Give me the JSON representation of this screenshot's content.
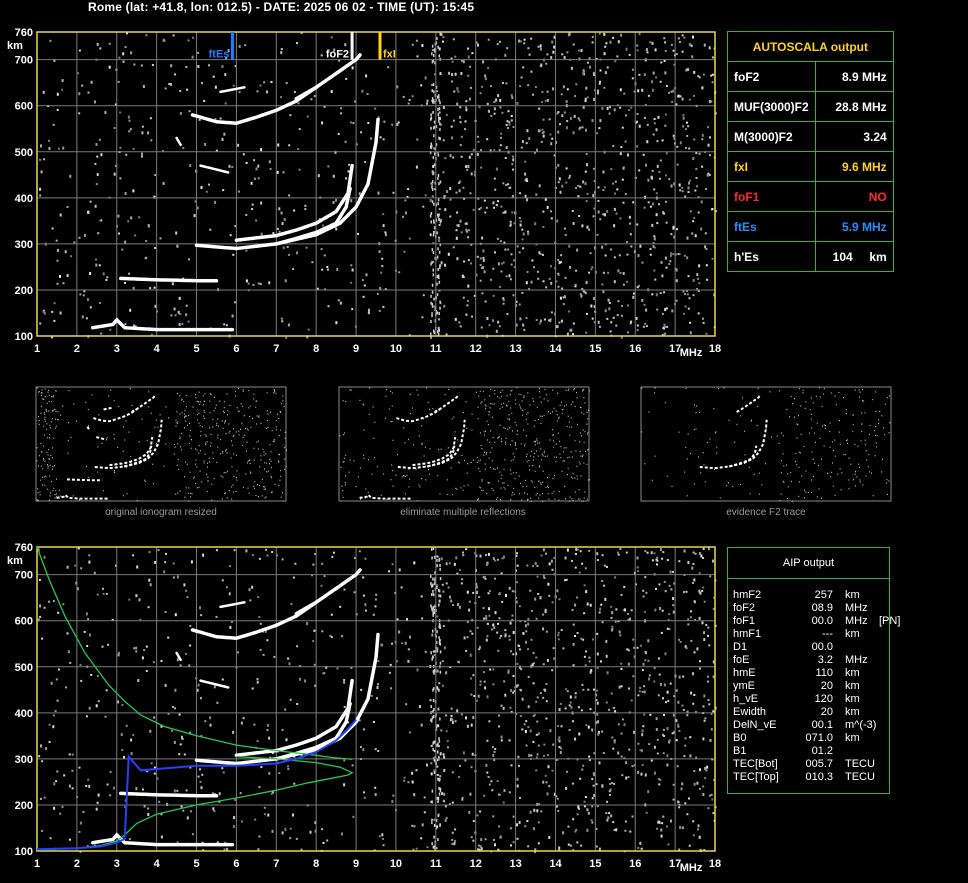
{
  "header": {
    "title": "Rome (lat: +41.8, lon: 012.5) - DATE: 2025 06 02 - TIME (UT): 15:45"
  },
  "colors": {
    "grid": "#7a7a7a",
    "axis": "#e8d94a",
    "panel_border": "#2eb04a",
    "profile_green": "#27c84a",
    "profile_blue": "#2440ff",
    "ftEs_marker": "#1e7dff",
    "fxI_marker": "#ffd21f",
    "text_yellow": "#ffd21f",
    "text_red": "#ff2a2a",
    "text_blue": "#2a8cff"
  },
  "chart_data": [
    {
      "type": "scatter",
      "name_on_chart": "",
      "xlabel": "MHz",
      "ylabel": "km",
      "xlim": [
        1,
        18
      ],
      "ylim": [
        100,
        760
      ],
      "x_ticks": [
        "1",
        "2",
        "3",
        "4",
        "5",
        "6",
        "7",
        "8",
        "9",
        "10",
        "11",
        "12",
        "13",
        "14",
        "15",
        "16",
        "17",
        "18"
      ],
      "y_ticks": [
        "100",
        "200",
        "300",
        "400",
        "500",
        "600",
        "700",
        "760"
      ],
      "grid": true,
      "markers": [
        {
          "label": "ftEs",
          "x": 5.9,
          "color": "#1e7dff"
        },
        {
          "label": "foF2",
          "x": 8.9,
          "color": "#ffffff"
        },
        {
          "label": "fxI",
          "x": 9.6,
          "color": "#ffd21f"
        }
      ],
      "traces": {
        "es_layer": [
          [
            2.4,
            118
          ],
          [
            2.9,
            125
          ],
          [
            3.0,
            135
          ],
          [
            3.2,
            118
          ],
          [
            4,
            114
          ],
          [
            5,
            114
          ],
          [
            5.9,
            114
          ]
        ],
        "es_second": [
          [
            3.1,
            225
          ],
          [
            4,
            222
          ],
          [
            5,
            220
          ],
          [
            5.5,
            220
          ]
        ],
        "f2_ordinary": [
          [
            5,
            297
          ],
          [
            6,
            290
          ],
          [
            7,
            300
          ],
          [
            7.5,
            312
          ],
          [
            8,
            325
          ],
          [
            8.5,
            345
          ],
          [
            8.75,
            380
          ],
          [
            8.85,
            420
          ]
        ],
        "f2_ordinary_upper": [
          [
            6,
            308
          ],
          [
            7,
            318
          ],
          [
            7.5,
            330
          ],
          [
            8,
            345
          ],
          [
            8.5,
            370
          ],
          [
            8.8,
            410
          ],
          [
            8.9,
            470
          ]
        ],
        "f2_extraordinary": [
          [
            7,
            300
          ],
          [
            8,
            320
          ],
          [
            8.6,
            345
          ],
          [
            9.0,
            380
          ],
          [
            9.3,
            430
          ],
          [
            9.5,
            520
          ],
          [
            9.55,
            570
          ]
        ],
        "f2_second_hop": [
          [
            4.9,
            580
          ],
          [
            5.5,
            565
          ],
          [
            6,
            562
          ],
          [
            6.5,
            575
          ],
          [
            7,
            590
          ],
          [
            7.5,
            610
          ],
          [
            8,
            640
          ]
        ],
        "f2_second_hop_x": [
          [
            7.5,
            615
          ],
          [
            8,
            640
          ],
          [
            8.5,
            670
          ],
          [
            9.0,
            700
          ],
          [
            9.1,
            710
          ]
        ],
        "stray_1": [
          [
            5.6,
            630
          ],
          [
            6.2,
            640
          ]
        ],
        "stray_2": [
          [
            5.1,
            470
          ],
          [
            5.8,
            455
          ]
        ],
        "stray_3": [
          [
            4.5,
            530
          ],
          [
            4.6,
            515
          ]
        ]
      }
    },
    {
      "type": "scatter",
      "name_on_chart": "",
      "xlabel": "MHz",
      "ylabel": "km",
      "xlim": [
        1,
        18
      ],
      "ylim": [
        100,
        760
      ],
      "x_ticks": [
        "1",
        "2",
        "3",
        "4",
        "5",
        "6",
        "7",
        "8",
        "9",
        "10",
        "11",
        "12",
        "13",
        "14",
        "15",
        "16",
        "17",
        "18"
      ],
      "y_ticks": [
        "100",
        "200",
        "300",
        "400",
        "500",
        "600",
        "700",
        "760"
      ],
      "grid": true,
      "series": [
        {
          "color": "#27c84a",
          "x": [
            1,
            1.3,
            1.7,
            2.2,
            2.8,
            3.2,
            3.6,
            4.2,
            5,
            6,
            7,
            7.8,
            8.4,
            8.8,
            8.9
          ],
          "y": [
            760,
            690,
            610,
            530,
            460,
            425,
            395,
            370,
            350,
            330,
            318,
            310,
            303,
            300,
            299
          ]
        },
        {
          "color": "#27c84a",
          "x": [
            1,
            2,
            2.6,
            3.0,
            3.2,
            3.5,
            4,
            5,
            6,
            7,
            7.8,
            8.4,
            8.8,
            8.9,
            8.6,
            8.0,
            7.0,
            6.0
          ],
          "y": [
            103,
            106,
            112,
            122,
            135,
            160,
            180,
            200,
            215,
            232,
            248,
            258,
            265,
            270,
            282,
            292,
            300,
            305
          ]
        },
        {
          "color": "#2440ff",
          "x": [
            1,
            2,
            2.6,
            3.0,
            3.2,
            3.3,
            3.6,
            4,
            5,
            6,
            7,
            7.5,
            8,
            8.5,
            8.8,
            9.0
          ],
          "y": [
            104,
            106,
            110,
            118,
            126,
            305,
            275,
            278,
            285,
            285,
            290,
            300,
            315,
            340,
            365,
            385
          ]
        }
      ],
      "traces_same_as_top": true
    }
  ],
  "thumbnails": [
    {
      "caption": "original ionogram resized"
    },
    {
      "caption": "eliminate multiple reflections"
    },
    {
      "caption": "evidence F2 trace"
    }
  ],
  "autoscala": {
    "title": "AUTOSCALA output",
    "rows": [
      {
        "key": "foF2",
        "value": "8.9 MHz",
        "color": "white"
      },
      {
        "key": "MUF(3000)F2",
        "value": "28.8 MHz",
        "color": "white"
      },
      {
        "key": "M(3000)F2",
        "value": "3.24",
        "color": "white"
      },
      {
        "key": "fxI",
        "value": "9.6 MHz",
        "color": "yellow"
      },
      {
        "key": "foF1",
        "value": "NO",
        "color": "red"
      },
      {
        "key": "ftEs",
        "value": "5.9 MHz",
        "color": "blue"
      },
      {
        "key": "h'Es",
        "value": "104     km",
        "color": "white"
      }
    ]
  },
  "aip": {
    "title": "AIP output",
    "rows": [
      {
        "k": "hmF2",
        "v": "257",
        "u": "km",
        "x": ""
      },
      {
        "k": "foF2",
        "v": "08.9",
        "u": "MHz",
        "x": ""
      },
      {
        "k": "foF1",
        "v": "00.0",
        "u": "MHz",
        "x": "[PN]"
      },
      {
        "k": "hmF1",
        "v": "---",
        "u": "km",
        "x": ""
      },
      {
        "k": "D1",
        "v": "00.0",
        "u": "",
        "x": ""
      },
      {
        "k": "foE",
        "v": "3.2",
        "u": "MHz",
        "x": ""
      },
      {
        "k": "hmE",
        "v": "110",
        "u": "km",
        "x": ""
      },
      {
        "k": "ymE",
        "v": "20",
        "u": "km",
        "x": ""
      },
      {
        "k": "h_vE",
        "v": "120",
        "u": "km",
        "x": ""
      },
      {
        "k": "Ewidth",
        "v": "20",
        "u": "km",
        "x": ""
      },
      {
        "k": "DelN_vE",
        "v": "00.1",
        "u": "m^(-3)",
        "x": ""
      },
      {
        "k": "B0",
        "v": "071.0",
        "u": "km",
        "x": ""
      },
      {
        "k": "B1",
        "v": "01.2",
        "u": "",
        "x": ""
      },
      {
        "k": "TEC[Bot]",
        "v": "005.7",
        "u": "TECU",
        "x": ""
      },
      {
        "k": "TEC[Top]",
        "v": "010.3",
        "u": "TECU",
        "x": ""
      }
    ]
  }
}
